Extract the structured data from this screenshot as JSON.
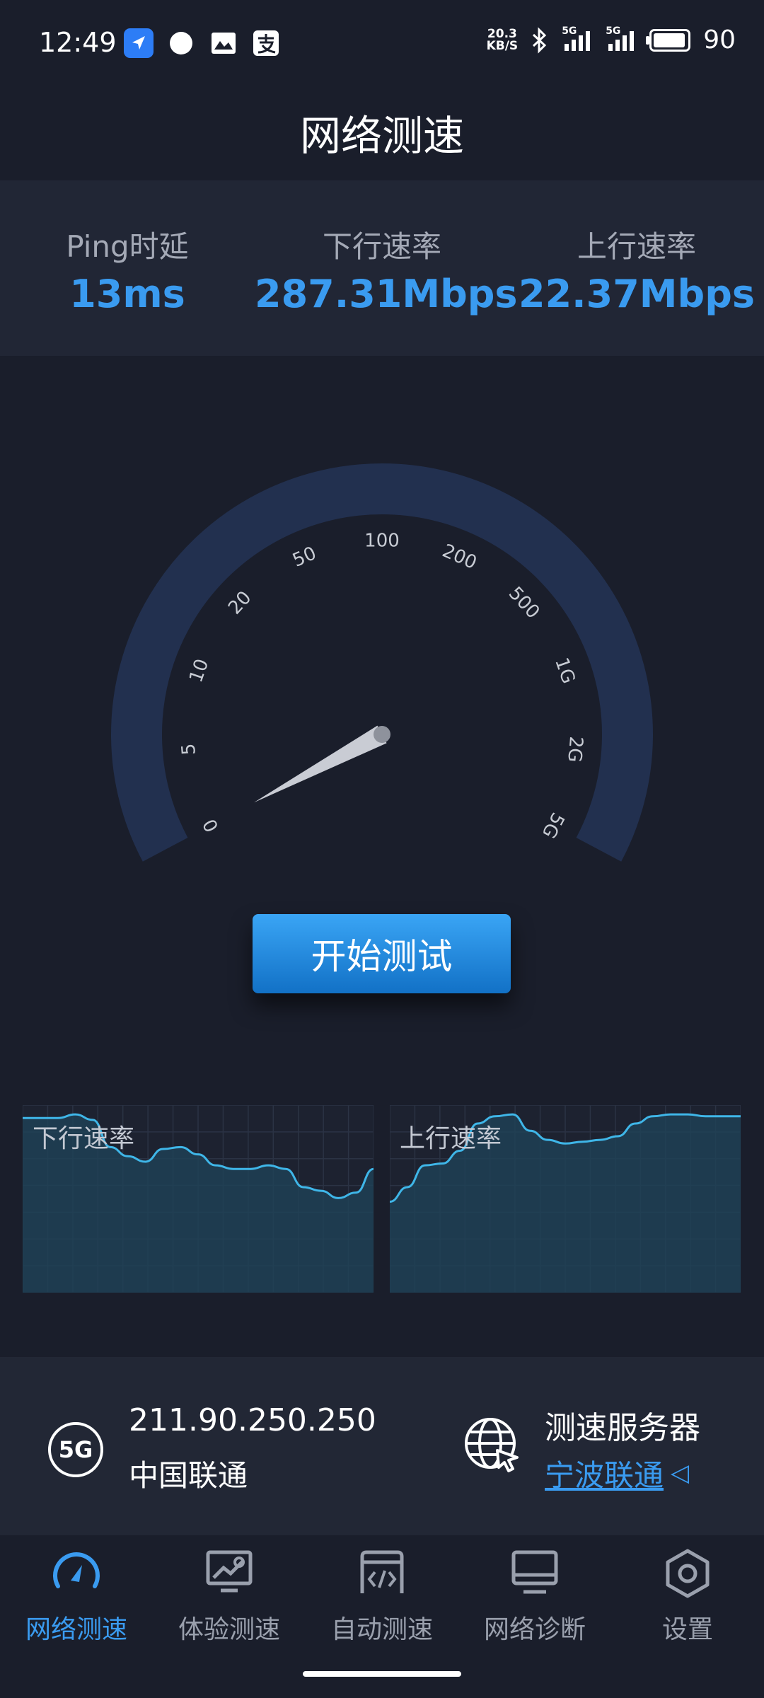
{
  "status_bar": {
    "time": "12:49",
    "net_speed_value": "20.3",
    "net_speed_unit": "KB/S",
    "signal1_label": "5G",
    "signal2_label": "5G",
    "battery": "90",
    "left_icons": [
      "navigation-app-icon",
      "chat-bubble-icon",
      "gallery-icon",
      "alipay-icon"
    ]
  },
  "page": {
    "title": "网络测速"
  },
  "stats": {
    "ping_label": "Ping时延",
    "ping_value": "13ms",
    "download_label": "下行速率",
    "download_value": "287.31Mbps",
    "upload_label": "上行速率",
    "upload_value": "22.37Mbps"
  },
  "gauge": {
    "ticks": [
      "0",
      "5",
      "10",
      "20",
      "50",
      "100",
      "200",
      "500",
      "1G",
      "2G",
      "5G"
    ],
    "needle_value": 0,
    "arc_color": "#22304f",
    "needle_color": "#c9ccd4"
  },
  "actions": {
    "start_label": "开始测试"
  },
  "chart_data": [
    {
      "type": "area",
      "title": "下行速率",
      "x": [
        0,
        1,
        2,
        3,
        4,
        5,
        6,
        7,
        8,
        9,
        10,
        11,
        12,
        13,
        14,
        15,
        16,
        17,
        18,
        19,
        20
      ],
      "values": [
        96,
        96,
        96,
        98,
        95,
        80,
        75,
        72,
        79,
        80,
        76,
        70,
        68,
        68,
        70,
        68,
        58,
        56,
        52,
        55,
        68
      ],
      "ylim": [
        0,
        100
      ],
      "color": "#3fb6e8"
    },
    {
      "type": "area",
      "title": "上行速率",
      "x": [
        0,
        1,
        2,
        3,
        4,
        5,
        6,
        7,
        8,
        9,
        10,
        11,
        12,
        13,
        14,
        15,
        16,
        17,
        18,
        19,
        20
      ],
      "values": [
        50,
        58,
        70,
        71,
        78,
        93,
        97,
        98,
        89,
        84,
        82,
        83,
        84,
        86,
        93,
        97,
        98,
        98,
        97,
        97,
        97
      ],
      "ylim": [
        0,
        100
      ],
      "color": "#3fb6e8"
    }
  ],
  "connection": {
    "network_type": "5G",
    "ip": "211.90.250.250",
    "isp": "中国联通",
    "server_title": "测速服务器",
    "server_name": "宁波联通",
    "server_chevron": "◁"
  },
  "nav": {
    "items": [
      {
        "label": "网络测速",
        "icon": "speedometer-icon",
        "active": true
      },
      {
        "label": "体验测速",
        "icon": "trend-monitor-icon",
        "active": false
      },
      {
        "label": "自动测速",
        "icon": "code-window-icon",
        "active": false
      },
      {
        "label": "网络诊断",
        "icon": "desktop-icon",
        "active": false
      },
      {
        "label": "设置",
        "icon": "settings-hexagon-icon",
        "active": false
      }
    ]
  },
  "colors": {
    "accent": "#3a9bf0",
    "background": "#1a1e2b",
    "panel": "#212635",
    "chart_fill": "#1f4258"
  }
}
